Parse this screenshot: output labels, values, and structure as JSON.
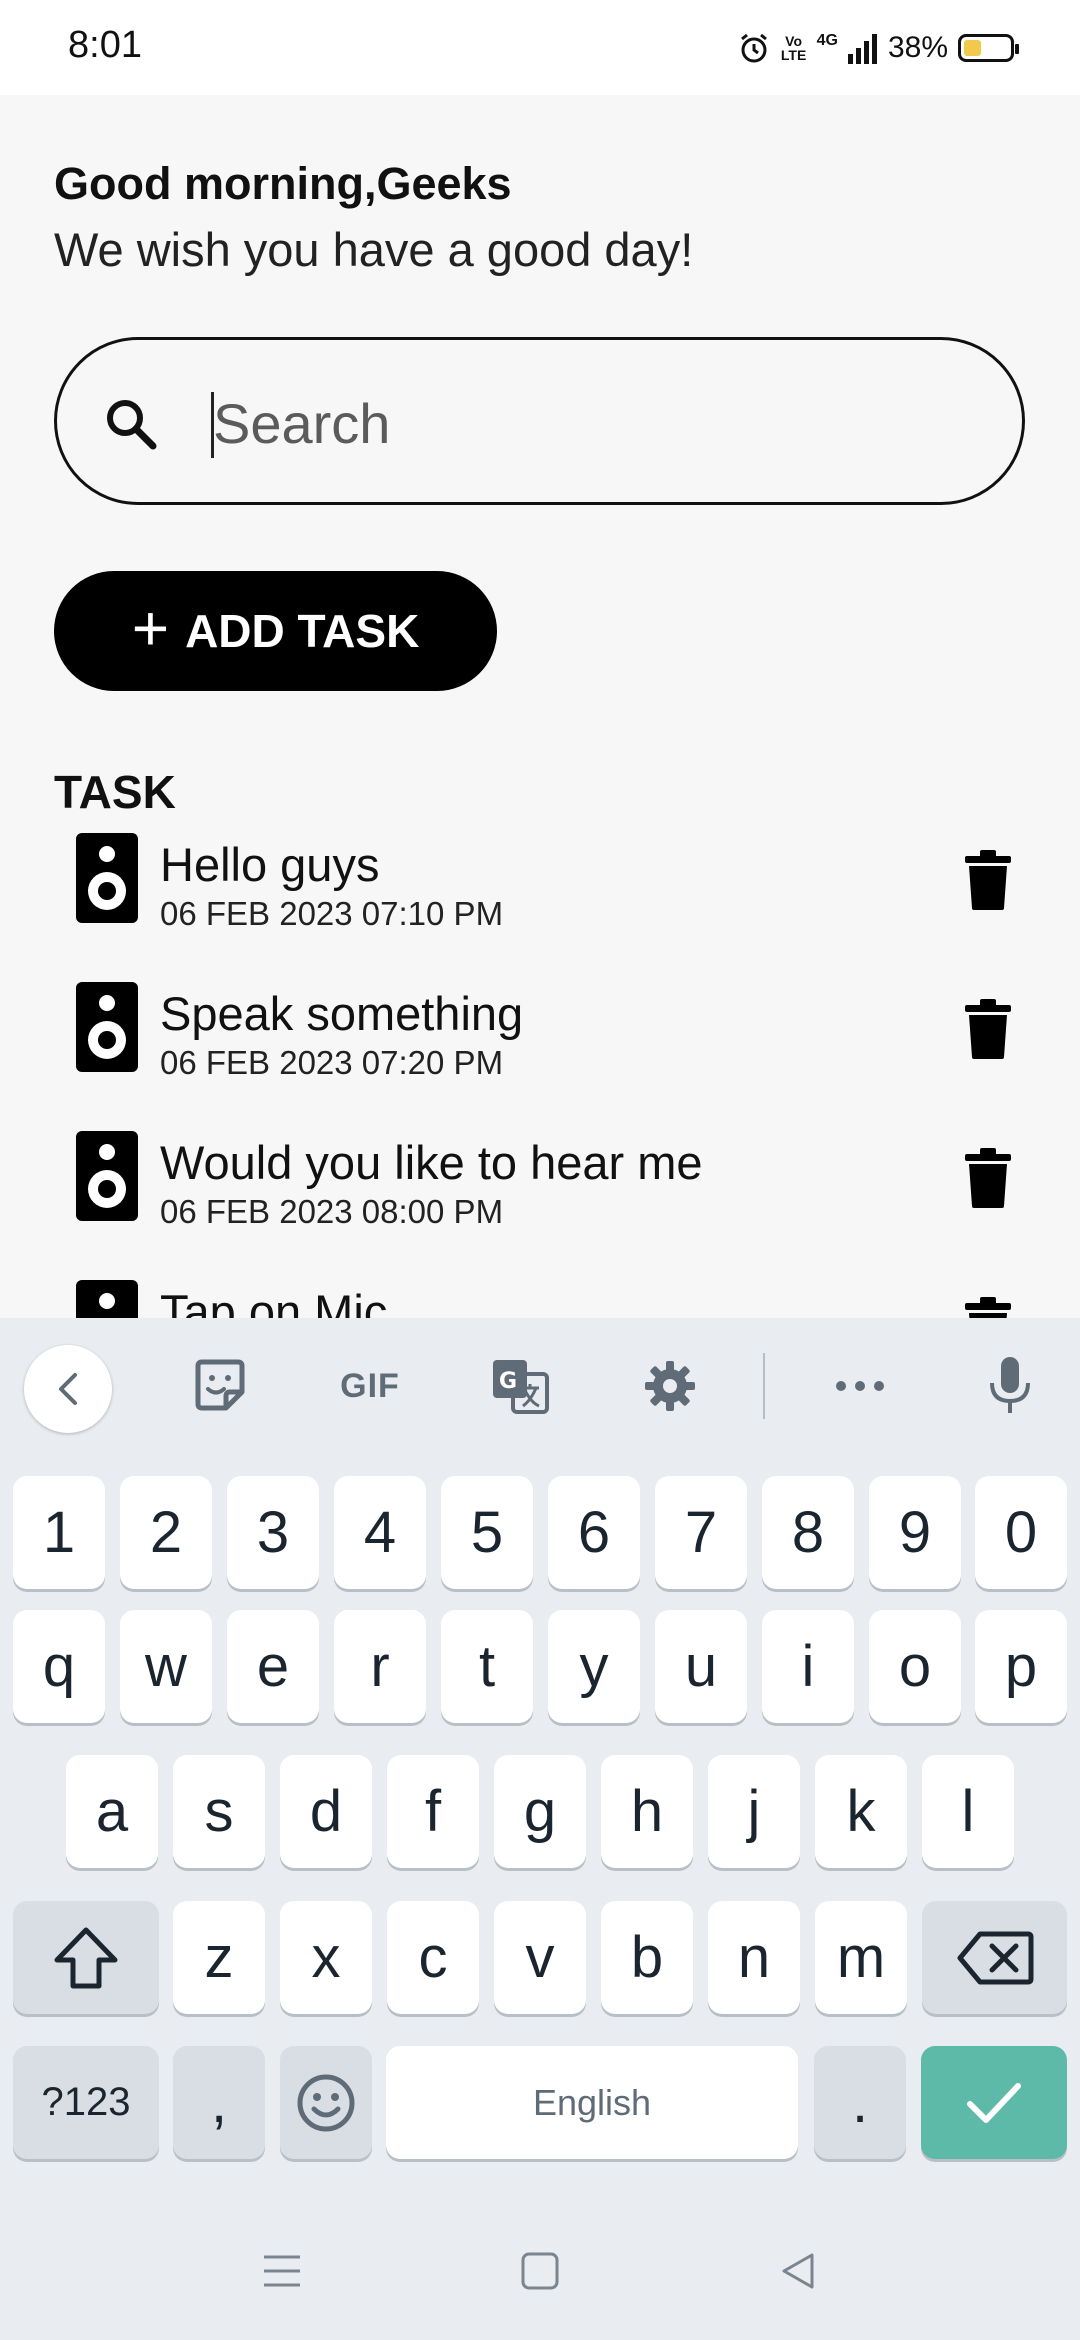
{
  "status_bar": {
    "time": "8:01",
    "network": "4G",
    "volte": "Vo LTE",
    "battery_percent": "38%",
    "battery_level": 0.38
  },
  "header": {
    "greeting": "Good morning,Geeks",
    "subtitle": "We wish you have a good day!"
  },
  "search": {
    "placeholder": "Search",
    "value": ""
  },
  "add_task": {
    "label": "ADD TASK"
  },
  "task_section": {
    "heading": "TASK",
    "tasks": [
      {
        "title": "Hello guys",
        "time": "06 FEB 2023 07:10 PM"
      },
      {
        "title": "Speak something",
        "time": "06 FEB 2023 07:20 PM"
      },
      {
        "title": "Would you like to hear me",
        "time": "06 FEB 2023 08:00 PM"
      },
      {
        "title": "Tap on Mic",
        "time": ""
      }
    ]
  },
  "keyboard": {
    "toolbar": {
      "gif_label": "GIF"
    },
    "number_row": [
      "1",
      "2",
      "3",
      "4",
      "5",
      "6",
      "7",
      "8",
      "9",
      "0"
    ],
    "row1": [
      "q",
      "w",
      "e",
      "r",
      "t",
      "y",
      "u",
      "i",
      "o",
      "p"
    ],
    "row2": [
      "a",
      "s",
      "d",
      "f",
      "g",
      "h",
      "j",
      "k",
      "l"
    ],
    "row3": [
      "z",
      "x",
      "c",
      "v",
      "b",
      "n",
      "m"
    ],
    "symbols_label": "?123",
    "comma_label": ",",
    "space_label": "English",
    "period_label": "."
  },
  "colors": {
    "accent_done_key": "#5dbaa9",
    "battery_fill": "#f2c94c",
    "button_bg": "#000000"
  }
}
